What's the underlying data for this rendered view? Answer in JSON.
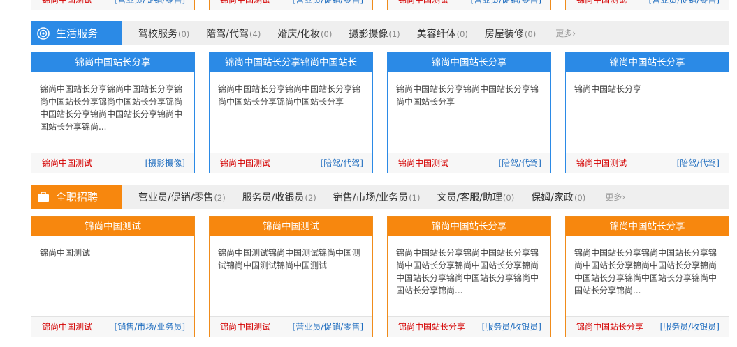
{
  "top_partial": [
    {
      "source": "锦尚中国测试",
      "tag": "[营业员/促销/零售]"
    },
    {
      "source": "锦尚中国测试",
      "tag": "[营业员/促销/零售]"
    },
    {
      "source": "锦尚中国测试",
      "tag": "[营业员/促销/零售]"
    },
    {
      "source": "锦尚中国测试",
      "tag": "[营业员/促销/零售]"
    }
  ],
  "life": {
    "title": "生活服务",
    "categories": [
      {
        "label": "驾校服务",
        "count": "(0)"
      },
      {
        "label": "陪驾/代驾",
        "count": "(4)"
      },
      {
        "label": "婚庆/化妆",
        "count": "(0)"
      },
      {
        "label": "摄影摄像",
        "count": "(1)"
      },
      {
        "label": "美容纤体",
        "count": "(0)"
      },
      {
        "label": "房屋装修",
        "count": "(0)"
      }
    ],
    "more": "更多",
    "cards": [
      {
        "title": "锦尚中国站长分享",
        "body": "锦尚中国站长分享锦尚中国站长分享锦尚中国站长分享锦尚中国站长分享锦尚中国站长分享锦尚中国站长分享锦尚中国站长分享锦尚...",
        "source": "锦尚中国测试",
        "tag": "[摄影摄像]"
      },
      {
        "title": "锦尚中国站长分享锦尚中国站长",
        "body": "锦尚中国站长分享锦尚中国站长分享锦尚中国站长分享锦尚中国站长分享",
        "source": "锦尚中国测试",
        "tag": "[陪驾/代驾]"
      },
      {
        "title": "锦尚中国站长分享",
        "body": "锦尚中国站长分享锦尚中国站长分享锦尚中国站长分享",
        "source": "锦尚中国测试",
        "tag": "[陪驾/代驾]"
      },
      {
        "title": "锦尚中国站长分享",
        "body": "锦尚中国站长分享",
        "source": "锦尚中国测试",
        "tag": "[陪驾/代驾]"
      }
    ]
  },
  "jobs": {
    "title": "全职招聘",
    "categories": [
      {
        "label": "营业员/促销/零售",
        "count": "(2)"
      },
      {
        "label": "服务员/收银员",
        "count": "(2)"
      },
      {
        "label": "销售/市场/业务员",
        "count": "(1)"
      },
      {
        "label": "文员/客服/助理",
        "count": "(0)"
      },
      {
        "label": "保姆/家政",
        "count": "(0)"
      }
    ],
    "more": "更多",
    "cards": [
      {
        "title": "锦尚中国测试",
        "body": "锦尚中国测试",
        "source": "锦尚中国测试",
        "tag": "[销售/市场/业务员]"
      },
      {
        "title": "锦尚中国测试",
        "body": "锦尚中国测试锦尚中国测试锦尚中国测试锦尚中国测试锦尚中国测试",
        "source": "锦尚中国测试",
        "tag": "[营业员/促销/零售]"
      },
      {
        "title": "锦尚中国站长分享",
        "body": "锦尚中国站长分享锦尚中国站长分享锦尚中国站长分享锦尚中国站长分享锦尚中国站长分享锦尚中国站长分享锦尚中国站长分享锦尚...",
        "source": "锦尚中国站长分享",
        "tag": "[服务员/收银员]"
      },
      {
        "title": "锦尚中国站长分享",
        "body": "锦尚中国站长分享锦尚中国站长分享锦尚中国站长分享锦尚中国站长分享锦尚中国站长分享锦尚中国站长分享锦尚中国站长分享锦尚...",
        "source": "锦尚中国站长分享",
        "tag": "[服务员/收银员]"
      }
    ]
  }
}
